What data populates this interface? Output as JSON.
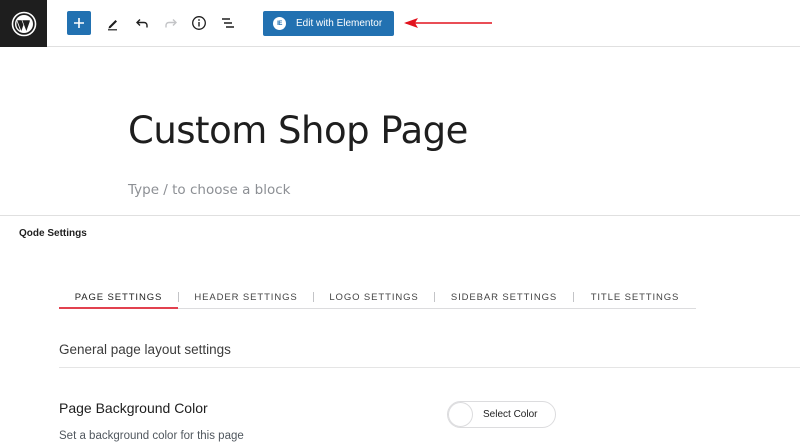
{
  "toolbar": {
    "elementor_label": "Edit with Elementor",
    "elementor_icon_glyph": "IE",
    "accent": "#2271b1",
    "arrow_color": "#e2131e"
  },
  "editor": {
    "title": "Custom Shop Page",
    "placeholder": "Type / to choose a block"
  },
  "settings": {
    "panel_title": "Qode Settings",
    "tabs": [
      {
        "label": "PAGE SETTINGS",
        "active": true
      },
      {
        "label": "HEADER SETTINGS",
        "active": false
      },
      {
        "label": "LOGO SETTINGS",
        "active": false
      },
      {
        "label": "SIDEBAR SETTINGS",
        "active": false
      },
      {
        "label": "TITLE SETTINGS",
        "active": false
      }
    ],
    "active_tab_color": "#e2414f",
    "section_title": "General page layout settings",
    "fields": [
      {
        "label": "Page Background Color",
        "description": "Set a background color for this page",
        "button_label": "Select Color"
      }
    ]
  }
}
